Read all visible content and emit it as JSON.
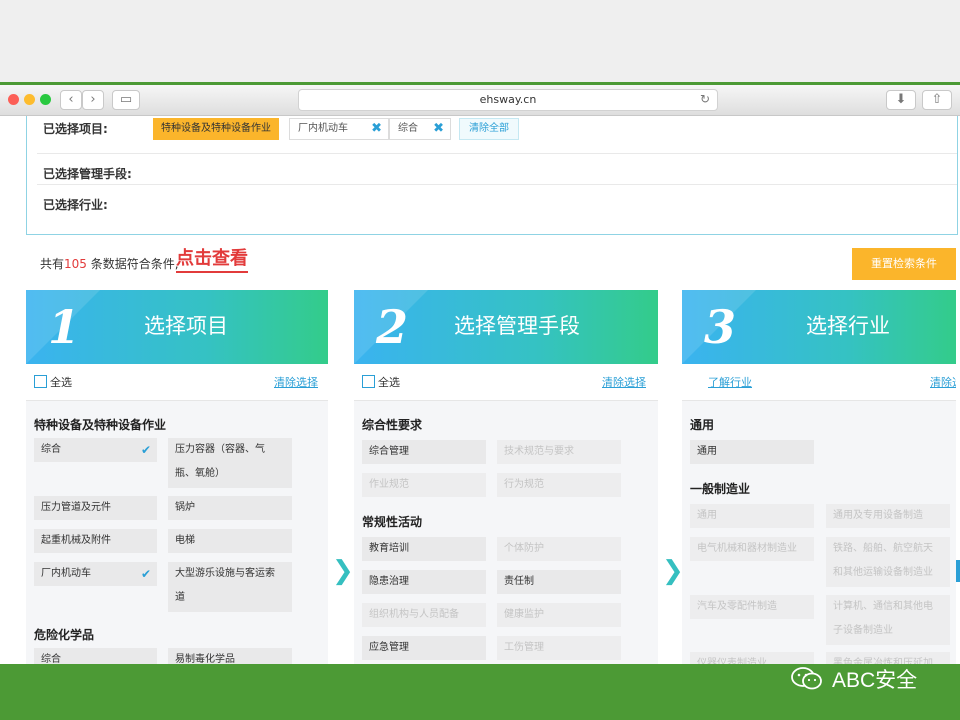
{
  "browser": {
    "url": "ehsway.cn",
    "back": "‹",
    "forward": "›",
    "sidebar": "▭",
    "reload": "↻",
    "download": "⬇",
    "share": "⇧"
  },
  "selection": {
    "project_label": "已选择项目:",
    "tags": [
      "特种设备及特种设备作业",
      "厂内机动车",
      "综合"
    ],
    "remove_icon": "✖",
    "clear_all": "清除全部",
    "method_label": "已选择管理手段:",
    "industry_label": "已选择行业:"
  },
  "results": {
    "prefix": "共有",
    "count": "105",
    "suffix": "条数据符合条件,",
    "view_link": "点击查看",
    "reset_button": "重置检索条件"
  },
  "columns": [
    {
      "number": "1",
      "title": "选择项目",
      "select_all": "全选",
      "clear": "清除选择",
      "sections": [
        {
          "title": "特种设备及特种设备作业",
          "items": [
            "综合",
            "压力容器（容器、气",
            "瓶、氧舱）",
            "压力管道及元件",
            "锅炉",
            "起重机械及附件",
            "电梯",
            "厂内机动车",
            "大型游乐设施与客运索",
            "道"
          ]
        },
        {
          "title": "危险化学品",
          "items": [
            "综合",
            "易制毒化学品"
          ]
        }
      ]
    },
    {
      "number": "2",
      "title": "选择管理手段",
      "select_all": "全选",
      "clear": "清除选择",
      "sections": [
        {
          "title": "综合性要求",
          "items": [
            "综合管理",
            "技术规范与要求",
            "作业规范",
            "行为规范"
          ]
        },
        {
          "title": "常规性活动",
          "items": [
            "教育培训",
            "个体防护",
            "隐患治理",
            "责任制",
            "组织机构与人员配备",
            "健康监护",
            "应急管理",
            "工伤管理"
          ]
        }
      ]
    },
    {
      "number": "3",
      "title": "选择行业",
      "learn": "了解行业",
      "clear": "清除选",
      "sections": [
        {
          "title": "通用",
          "items": [
            "通用"
          ]
        },
        {
          "title": "一般制造业",
          "items": [
            "通用",
            "通用及专用设备制造",
            "电气机械和器材制造业",
            "铁路、船舶、航空航天",
            "和其他运输设备制造业",
            "汽车及零配件制造",
            "计算机、通信和其他电",
            "子设备制造业",
            "仪器仪表制造业",
            "黑色金属冶炼和压延加"
          ]
        }
      ]
    }
  ],
  "icons": {
    "check": "✔",
    "arrow": "❯"
  },
  "watermark": {
    "icon": "wechat-icon",
    "text": "ABC安全"
  }
}
